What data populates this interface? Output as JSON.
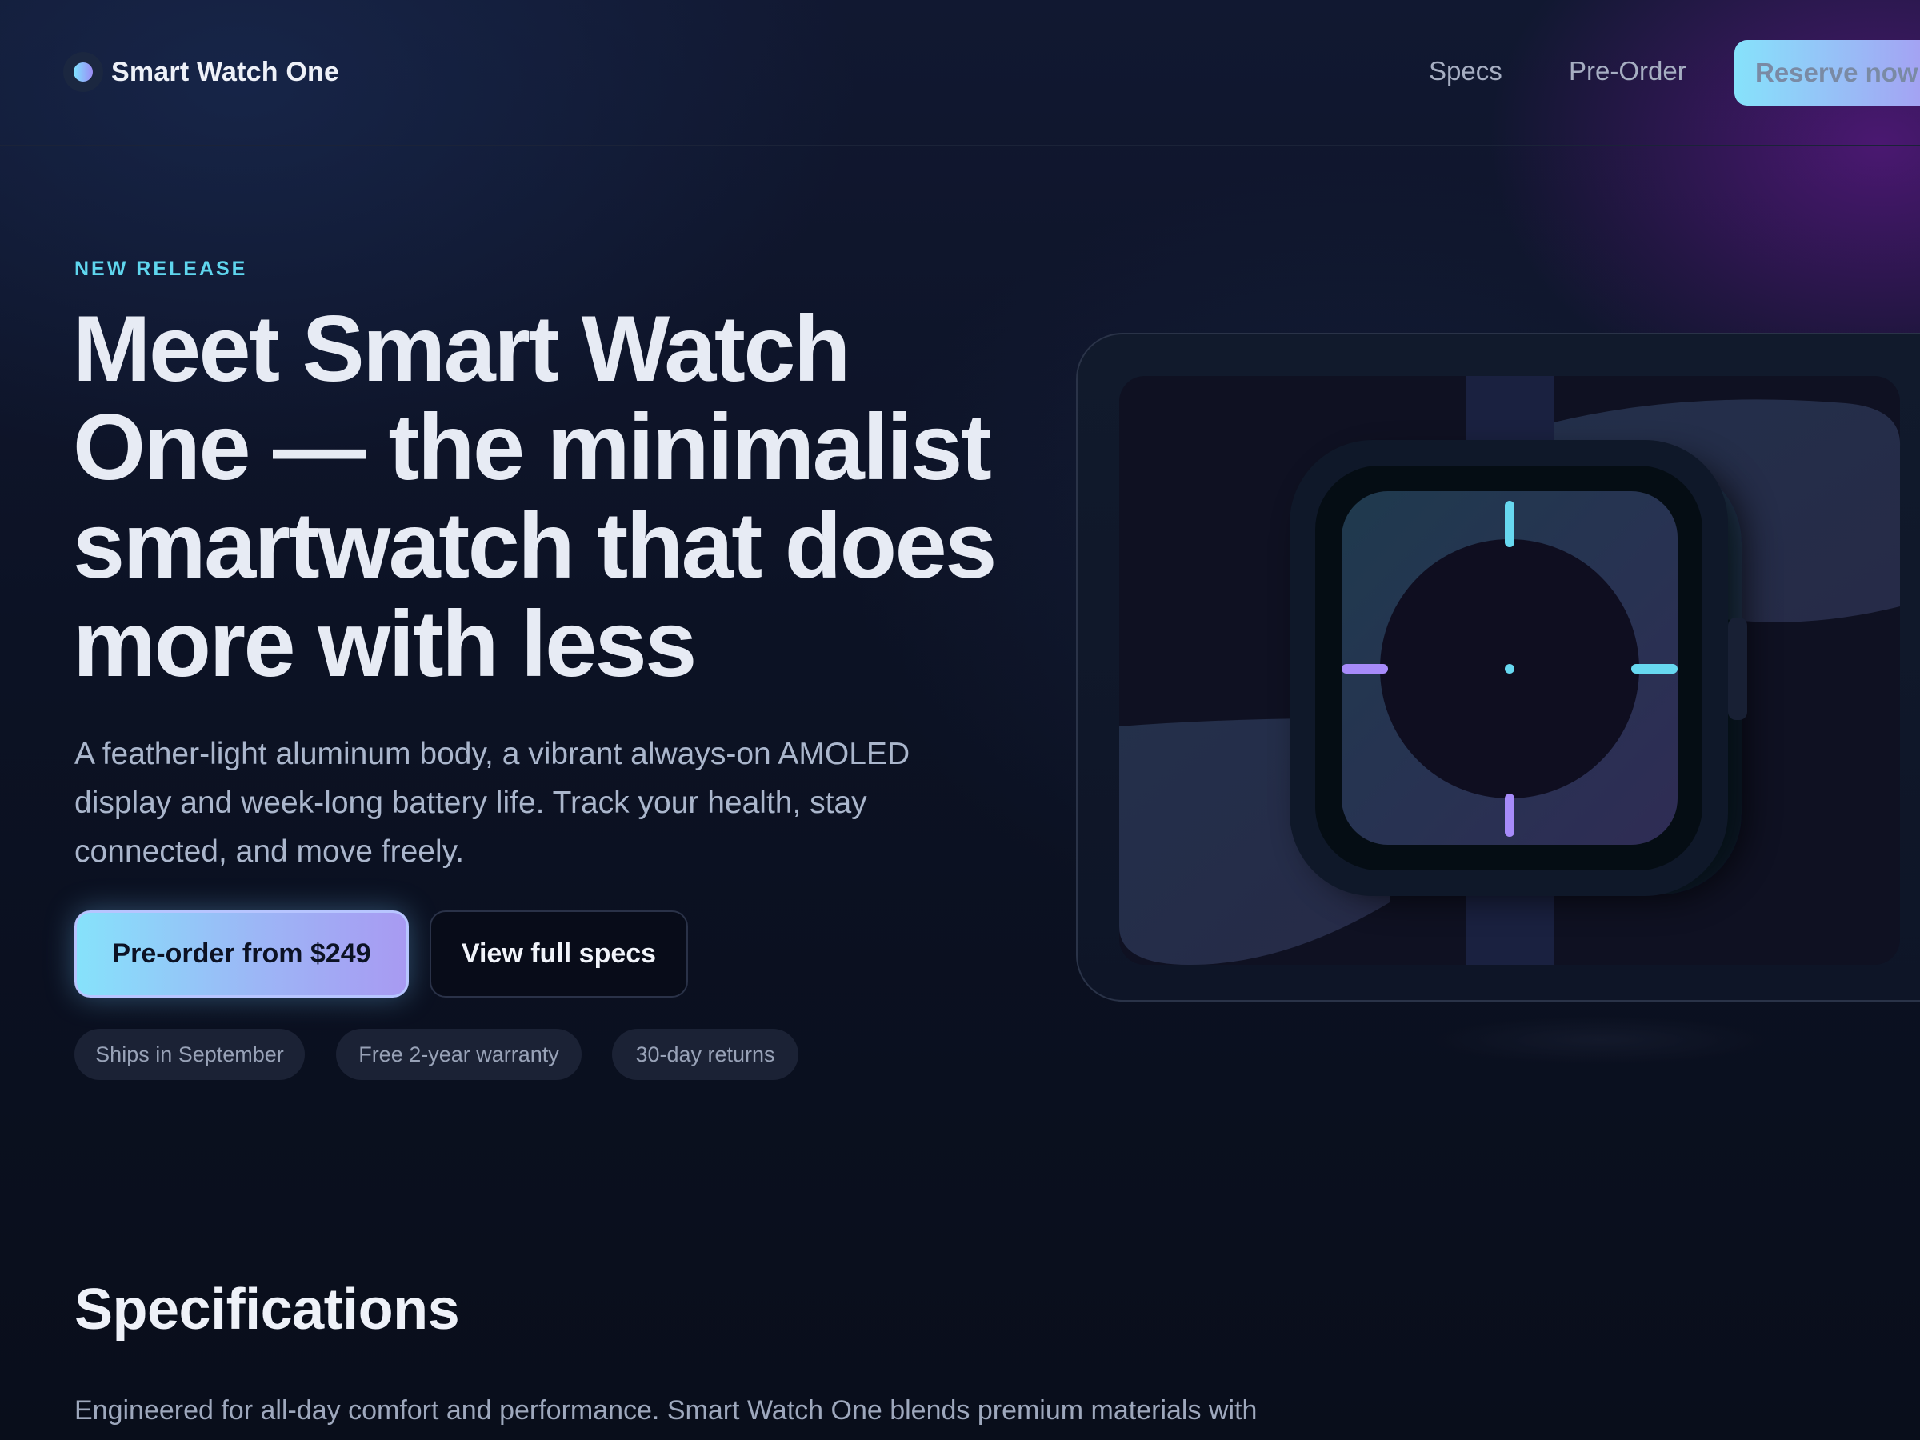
{
  "header": {
    "brand_name": "Smart Watch One",
    "nav": {
      "specs": "Specs",
      "preorder": "Pre-Order"
    },
    "cta": "Reserve now"
  },
  "hero": {
    "eyebrow": "NEW RELEASE",
    "headline": "Meet Smart Watch One — the minimalist smartwatch that does more with less",
    "subcopy": "A feather-light aluminum body, a vibrant always-on AMOLED display and week-long battery life. Track your health, stay connected, and move freely.",
    "primary_button": "Pre-order from $249",
    "secondary_button": "View full specs",
    "chips": [
      "Ships in September",
      "Free 2-year warranty",
      "30-day returns"
    ]
  },
  "specs": {
    "title": "Specifications",
    "body": "Engineered for all-day comfort and performance. Smart Watch One blends premium materials with thoughtful software to keep you moving."
  },
  "colors": {
    "accent_cyan": "#5fd6ee",
    "accent_violet": "#a78bfa",
    "background": "#0a0f1e"
  }
}
